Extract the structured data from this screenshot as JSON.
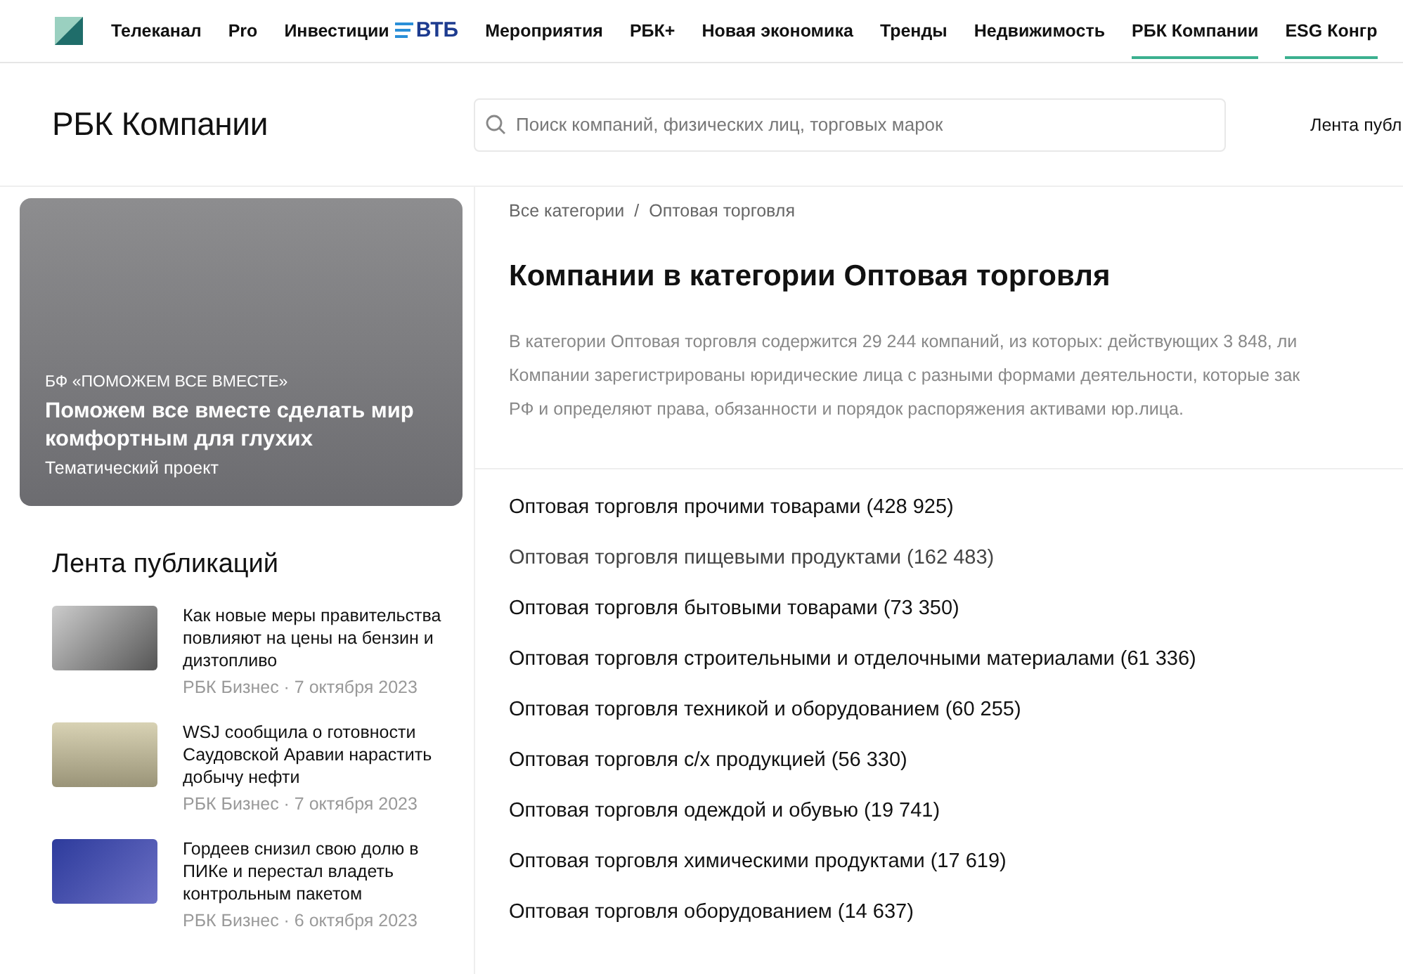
{
  "top_nav": {
    "items": [
      {
        "label": "Телеканал",
        "underlined": false
      },
      {
        "label": "Pro",
        "underlined": false
      },
      {
        "label": "Инвестиции",
        "partner": "ВТБ",
        "underlined": false
      },
      {
        "label": "Мероприятия",
        "underlined": false
      },
      {
        "label": "РБК+",
        "underlined": false
      },
      {
        "label": "Новая экономика",
        "underlined": false
      },
      {
        "label": "Тренды",
        "underlined": false
      },
      {
        "label": "Недвижимость",
        "underlined": false
      },
      {
        "label": "РБК Компании",
        "underlined": true
      },
      {
        "label": "ESG Конгр",
        "underlined": true
      }
    ]
  },
  "header": {
    "title": "РБК Компании",
    "search": {
      "placeholder": "Поиск компаний, физических лиц, торговых марок"
    },
    "link": "Лента публ"
  },
  "promo": {
    "kicker": "БФ «ПОМОЖЕМ ВСЕ ВМЕСТЕ»",
    "title": "Поможем все вместе сделать мир комфортным для глухих",
    "tag": "Тематический проект"
  },
  "feed": {
    "title": "Лента публикаций",
    "items": [
      {
        "title": "Как новые меры правительства повлияют на цены на бензин и дизтопливо",
        "meta": "РБК Бизнес · 7 октября 2023"
      },
      {
        "title": "WSJ сообщила о готовности Саудовской Аравии нарастить добычу нефти",
        "meta": "РБК Бизнес · 7 октября 2023"
      },
      {
        "title": "Гордеев снизил свою долю в ПИКе и перестал владеть контрольным пакетом",
        "meta": "РБК Бизнес · 6 октября 2023"
      }
    ]
  },
  "breadcrumbs": {
    "items": [
      "Все категории",
      "Оптовая торговля"
    ],
    "separator": "/"
  },
  "page_title": "Компании в категории Оптовая торговля",
  "description_lines": [
    "В категории Оптовая торговля содержится 29 244 компаний, из которых: действующих 3 848, ли",
    "Компании зарегистрированы юридические лица с разными формами деятельности, которые зак",
    "РФ и определяют права, обязанности и порядок распоряжения активами юр.лица."
  ],
  "categories": [
    {
      "label": "Оптовая торговля прочими товарами (428 925)",
      "hovered": false
    },
    {
      "label": "Оптовая торговля пищевыми продуктами (162 483)",
      "hovered": true
    },
    {
      "label": "Оптовая торговля бытовыми товарами (73 350)",
      "hovered": false
    },
    {
      "label": "Оптовая торговля строительными и отделочными материалами (61 336)",
      "hovered": false
    },
    {
      "label": "Оптовая торговля техникой и оборудованием (60 255)",
      "hovered": false
    },
    {
      "label": "Оптовая торговля с/х продукцией (56 330)",
      "hovered": false
    },
    {
      "label": "Оптовая торговля одеждой и обувью (19 741)",
      "hovered": false
    },
    {
      "label": "Оптовая торговля химическими продуктами (17 619)",
      "hovered": false
    },
    {
      "label": "Оптовая торговля оборудованием (14 637)",
      "hovered": false
    }
  ]
}
